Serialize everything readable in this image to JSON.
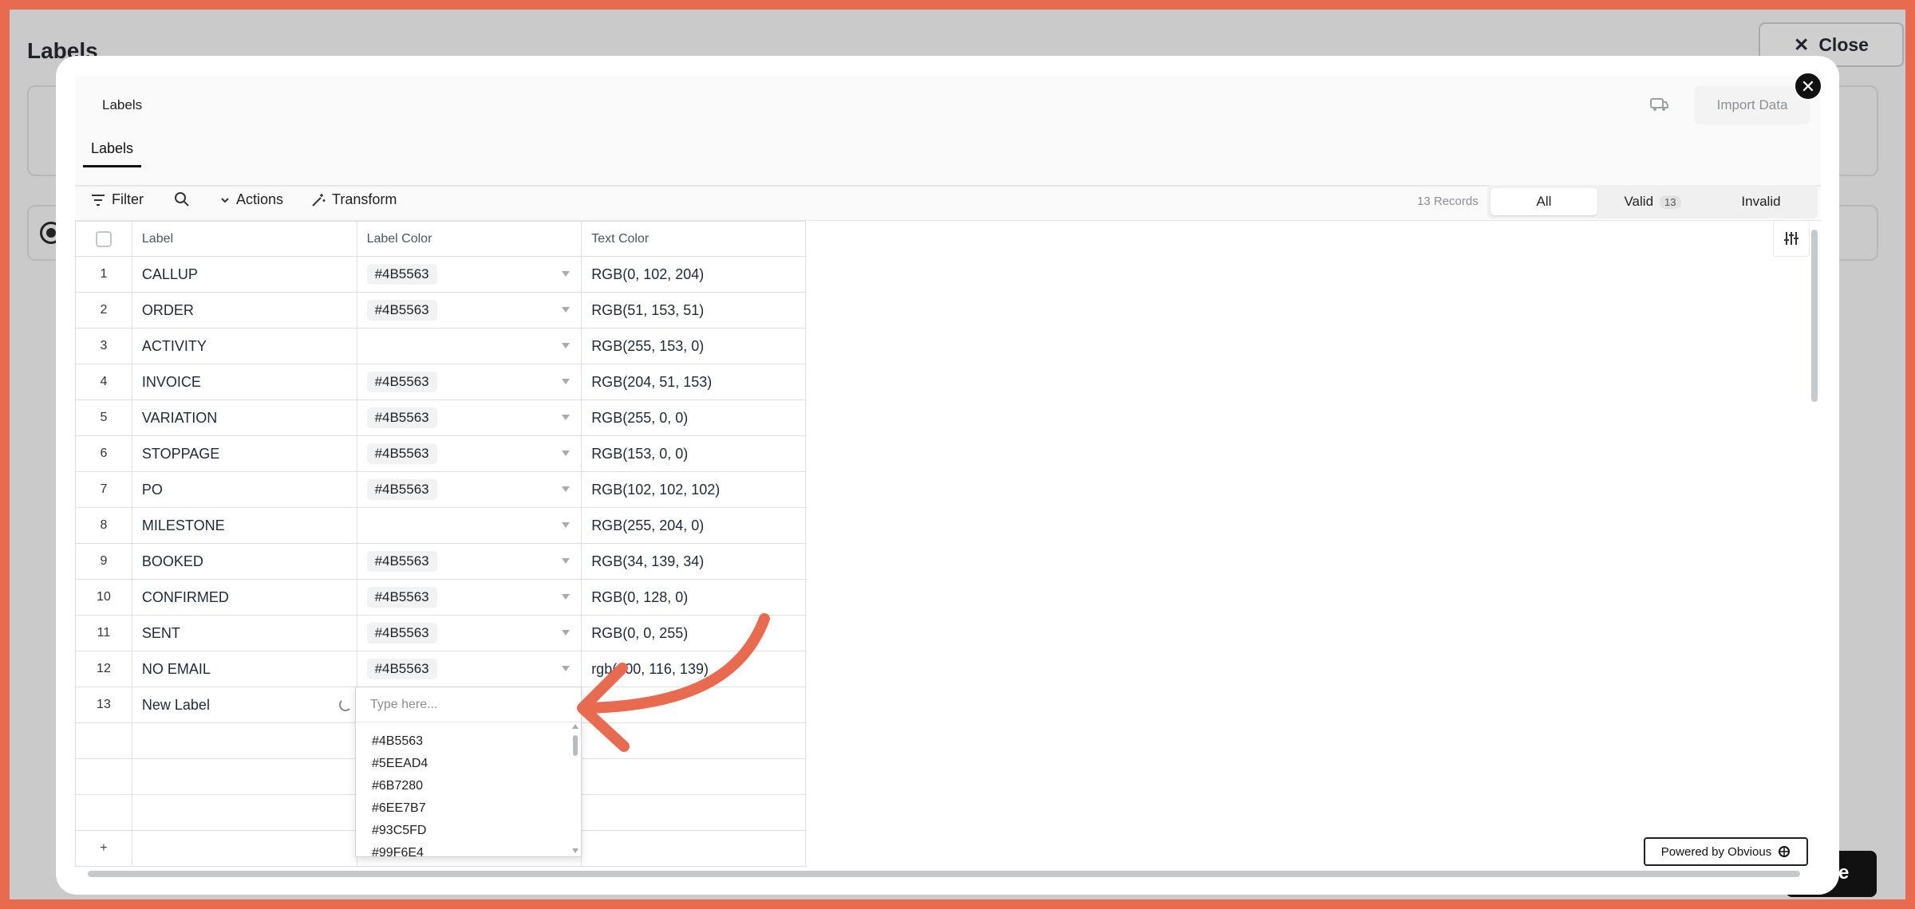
{
  "background": {
    "title": "Labels",
    "close_label": "Close",
    "button_partial_label": "e"
  },
  "modal": {
    "header_title": "Labels",
    "import_label": "Import Data",
    "tab_label": "Labels"
  },
  "toolbar": {
    "filter_label": "Filter",
    "actions_label": "Actions",
    "transform_label": "Transform",
    "records_count": "13 Records",
    "segments": {
      "all": "All",
      "valid": "Valid",
      "valid_count": "13",
      "invalid": "Invalid"
    }
  },
  "grid": {
    "columns": [
      "Label",
      "Label Color",
      "Text Color"
    ],
    "rows": [
      {
        "idx": "1",
        "label": "CALLUP",
        "color": "#4B5563",
        "text": "RGB(0, 102, 204)"
      },
      {
        "idx": "2",
        "label": "ORDER",
        "color": "#4B5563",
        "text": "RGB(51, 153, 51)"
      },
      {
        "idx": "3",
        "label": "ACTIVITY",
        "color": "",
        "text": "RGB(255, 153, 0)"
      },
      {
        "idx": "4",
        "label": "INVOICE",
        "color": "#4B5563",
        "text": "RGB(204, 51, 153)"
      },
      {
        "idx": "5",
        "label": "VARIATION",
        "color": "#4B5563",
        "text": "RGB(255, 0, 0)"
      },
      {
        "idx": "6",
        "label": "STOPPAGE",
        "color": "#4B5563",
        "text": "RGB(153, 0, 0)"
      },
      {
        "idx": "7",
        "label": "PO",
        "color": "#4B5563",
        "text": "RGB(102, 102, 102)"
      },
      {
        "idx": "8",
        "label": "MILESTONE",
        "color": "",
        "text": "RGB(255, 204, 0)"
      },
      {
        "idx": "9",
        "label": "BOOKED",
        "color": "#4B5563",
        "text": "RGB(34, 139, 34)"
      },
      {
        "idx": "10",
        "label": "CONFIRMED",
        "color": "#4B5563",
        "text": "RGB(0, 128, 0)"
      },
      {
        "idx": "11",
        "label": "SENT",
        "color": "#4B5563",
        "text": "RGB(0, 0, 255)"
      },
      {
        "idx": "12",
        "label": "NO EMAIL",
        "color": "#4B5563",
        "text": "rgb(100, 116, 139)"
      },
      {
        "idx": "13",
        "label": "New Label",
        "color": "",
        "text": ""
      }
    ],
    "add_row": "+"
  },
  "dropdown": {
    "placeholder": "Type here...",
    "options": [
      "#4B5563",
      "#5EEAD4",
      "#6B7280",
      "#6EE7B7",
      "#93C5FD",
      "#99F6E4"
    ]
  },
  "footer": {
    "powered_by": "Powered by Obvious"
  },
  "colors": {
    "frame": "#e96b4f",
    "annotation_arrow": "#e96b4f",
    "overlay": "#cacaca"
  }
}
